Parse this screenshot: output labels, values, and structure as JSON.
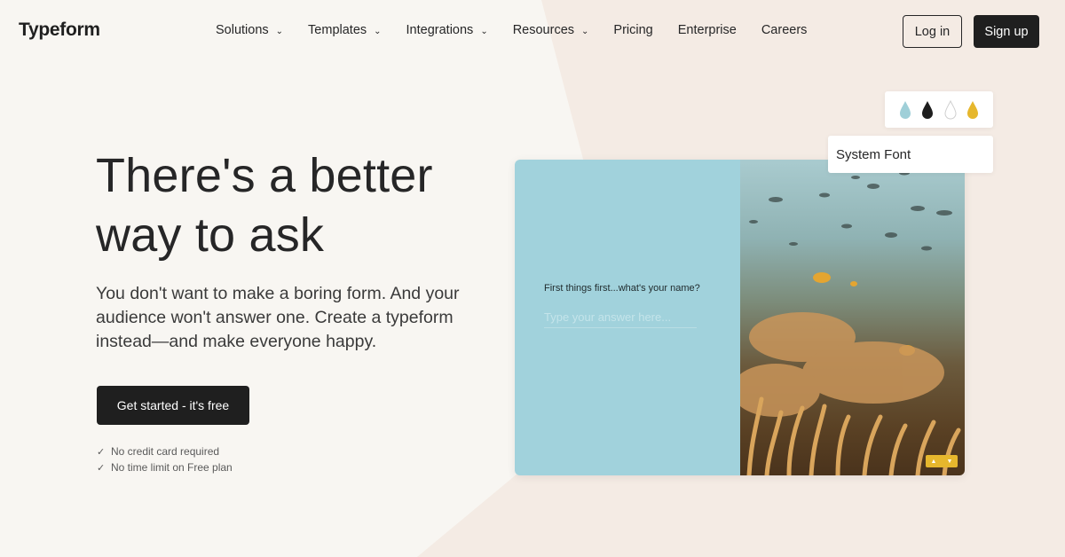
{
  "brand": {
    "logo": "Typeform"
  },
  "nav": {
    "items": [
      {
        "label": "Solutions",
        "has_dropdown": true
      },
      {
        "label": "Templates",
        "has_dropdown": true
      },
      {
        "label": "Integrations",
        "has_dropdown": true
      },
      {
        "label": "Resources",
        "has_dropdown": true
      },
      {
        "label": "Pricing",
        "has_dropdown": false
      },
      {
        "label": "Enterprise",
        "has_dropdown": false
      },
      {
        "label": "Careers",
        "has_dropdown": false
      }
    ],
    "login_label": "Log in",
    "signup_label": "Sign up"
  },
  "hero": {
    "title": "There's a better way to ask",
    "subtitle": "You don't want to make a boring form. And your audience won't answer one. Create a typeform instead—and make everyone happy.",
    "cta_label": "Get started - it's free",
    "perks": [
      "No credit card required",
      "No time limit on Free plan"
    ]
  },
  "preview": {
    "question": "First things first...what's your name?",
    "input_placeholder": "Type your answer here...",
    "swatch_colors": [
      "#9fcfd8",
      "#1e1e1e",
      "#ffffff",
      "#e6b72d"
    ],
    "font_label": "System Font"
  },
  "colors": {
    "background": "#f8f6f2",
    "accent_shape": "#f4ebe4",
    "primary_button": "#1f1f1f",
    "preview_panel": "#a1d2dc"
  }
}
